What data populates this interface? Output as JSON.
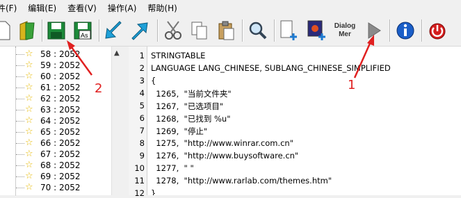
{
  "menu": [
    "件(F)",
    "编辑(E)",
    "查看(V)",
    "操作(A)",
    "帮助(H)"
  ],
  "toolbar": {
    "icons": [
      "new-file-icon",
      "open-file-icon",
      "save-icon",
      "save-as-icon",
      "arrow-left-icon",
      "arrow-right-icon",
      "cut-icon",
      "copy-icon",
      "paste-icon",
      "find-icon",
      "add-resource-icon",
      "add-image-icon",
      "dialog-menu-icon",
      "run-icon",
      "info-icon",
      "exit-icon"
    ],
    "save_as_label": "As",
    "dialog_label_1": "Dialog",
    "dialog_label_2": "Mer"
  },
  "tree": {
    "items": [
      "58 : 2052",
      "59 : 2052",
      "60 : 2052",
      "61 : 2052",
      "62 : 2052",
      "63 : 2052",
      "64 : 2052",
      "65 : 2052",
      "66 : 2052",
      "67 : 2052",
      "68 : 2052",
      "69 : 2052",
      "70 : 2052"
    ]
  },
  "editor": {
    "line_numbers": [
      "1",
      "2",
      "3",
      "4",
      "5",
      "6",
      "7",
      "8",
      "9",
      "10",
      "11",
      "12"
    ],
    "lines": [
      "STRINGTABLE",
      "LANGUAGE LANG_CHINESE, SUBLANG_CHINESE_SIMPLIFIED",
      "{",
      "  1265,  \"当前文件夹\"",
      "  1267,  \"已选项目\"",
      "  1268,  \"已找到 %u\"",
      "  1269,  \"停止\"",
      "  1275,  \"http://www.winrar.com.cn\"",
      "  1276,  \"http://www.buysoftware.cn\"",
      "  1277,  \" \"",
      "  1278,  \"http://www.rarlab.com/themes.htm\"",
      "}"
    ]
  },
  "annotations": {
    "label_1": "1",
    "label_2": "2"
  },
  "colors": {
    "accent_red": "#e02020"
  }
}
